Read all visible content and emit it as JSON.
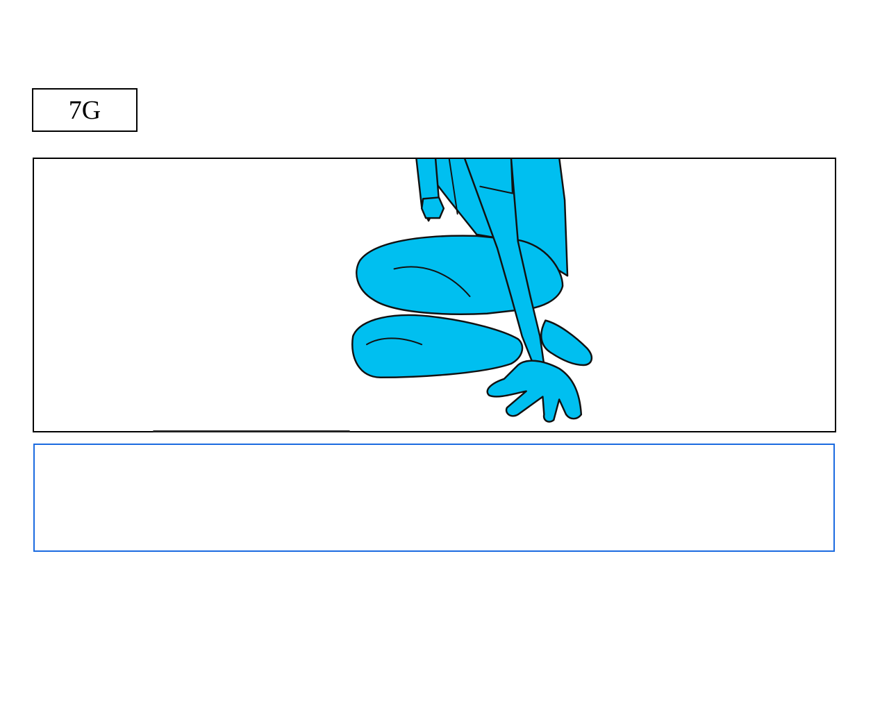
{
  "shot": {
    "label": "7G"
  },
  "panel": {
    "drawing": "crouching-figure-illustration",
    "fill_color": "#00bff0",
    "line_color": "#111111"
  },
  "notes": {
    "value": "",
    "border_color": "#1a6ae0"
  }
}
